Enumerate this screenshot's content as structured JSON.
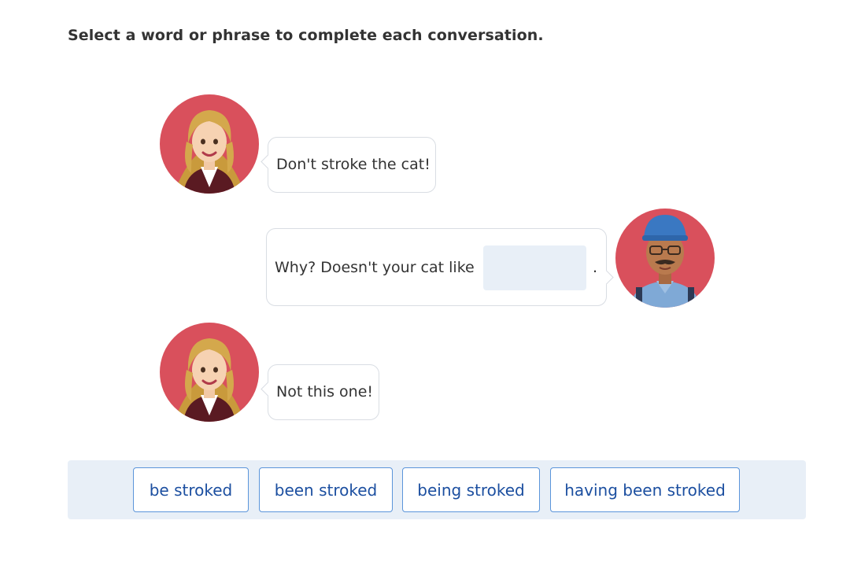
{
  "instruction": "Select a word or phrase to complete each conversation.",
  "conversation": [
    {
      "speaker": "woman",
      "text": "Don't stroke the cat!"
    },
    {
      "speaker": "man",
      "text_before": "Why? Doesn't your cat like",
      "blank": "",
      "text_after": "."
    },
    {
      "speaker": "woman",
      "text": "Not this one!"
    }
  ],
  "choices": [
    "be stroked",
    "been stroked",
    "being stroked",
    "having been stroked"
  ],
  "colors": {
    "avatar_bg": "#d9505c",
    "bubble_border": "#d9dde3",
    "choice_border": "#5b95da",
    "choice_text": "#1c4fa0",
    "panel_bg": "#e8eff7"
  }
}
